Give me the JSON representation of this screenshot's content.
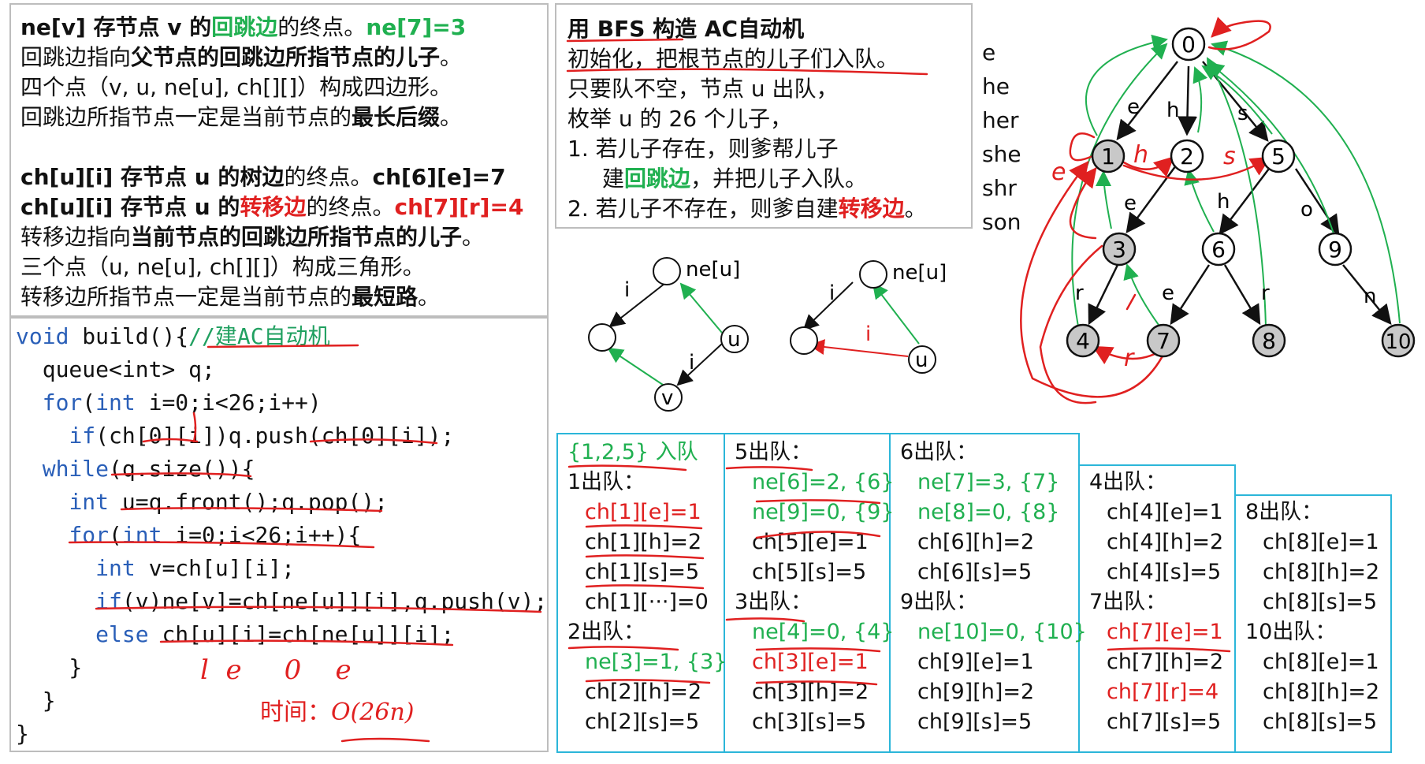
{
  "notes": {
    "line1": [
      "ne[v] 存节点 v 的",
      "回跳边",
      "的终点。",
      "ne[7]=3"
    ],
    "line2": [
      "回跳边指向",
      "父节点的回跳边所指节点的儿子",
      "。"
    ],
    "line3": "四个点（v, u, ne[u], ch[][]）构成四边形。",
    "line4": [
      "回跳边所指节点一定是当前节点的",
      "最长后缀",
      "。"
    ],
    "line5": [
      "ch[u][i] 存节点 u 的",
      "树边",
      "的终点。",
      "ch[6][e]=7"
    ],
    "line6": [
      "ch[u][i] 存节点 u 的",
      "转移边",
      "的终点。",
      "ch[7][r]=4"
    ],
    "line7": [
      "转移边指向",
      "当前节点的回跳边所指节点的儿子",
      "。"
    ],
    "line8": "三个点（u, ne[u], ch[][]）构成三角形。",
    "line9": [
      "转移边所指节点一定是当前节点的",
      "最短路",
      "。"
    ]
  },
  "algo": {
    "title": "用 BFS 构造 AC自动机",
    "lines": [
      "初始化，把根节点的儿子们入队。",
      "只要队不空，节点 u 出队，",
      "枚举 u 的 26 个儿子，",
      "1.  若儿子存在，则爹帮儿子"
    ],
    "line5": [
      "建",
      "回跳边",
      "，并把儿子入队。"
    ],
    "line6": [
      "2.  若儿子不存在，则爹自建",
      "转移边",
      "。"
    ]
  },
  "words": [
    "e",
    "he",
    "her",
    "she",
    "shr",
    "son"
  ],
  "code": {
    "l1": [
      "void",
      " build(){",
      "//建AC自动机"
    ],
    "l2": "  queue<int> q;",
    "l3": [
      "  ",
      "for",
      "(",
      "int",
      " i=0;i<26;i++)"
    ],
    "l4": [
      "    ",
      "if",
      "(ch[0][i])q.push(ch[0][i]);"
    ],
    "l5": [
      "  ",
      "while",
      "(q.size()){"
    ],
    "l6": [
      "    ",
      "int",
      " u=q.front();q.pop();"
    ],
    "l7": [
      "    ",
      "for",
      "(",
      "int",
      " i=0;i<26;i++){"
    ],
    "l8": [
      "      ",
      "int",
      " v=ch[u][i];"
    ],
    "l9": [
      "      ",
      "if",
      "(v)ne[v]=ch[ne[u]][i],q.push(v);"
    ],
    "l10": [
      "      ",
      "else",
      " ch[u][i]=ch[ne[u]][i];"
    ],
    "l11": "    }",
    "l12": "  }",
    "l13": "}",
    "time_label": "时间：",
    "time_value": "O(26n)",
    "scribble": "l  e     0    e"
  },
  "small_diagrams": {
    "quad": {
      "ne_u": "ne[u]",
      "u": "u",
      "v": "v",
      "i1": "i",
      "i2": "i"
    },
    "tri": {
      "ne_u": "ne[u]",
      "u": "u",
      "i1": "i",
      "i2": "i"
    }
  },
  "trie": {
    "nodes": [
      "0",
      "1",
      "2",
      "5",
      "3",
      "6",
      "9",
      "4",
      "7",
      "8",
      "10"
    ],
    "edge_labels": [
      "e",
      "h",
      "s",
      "e",
      "h",
      "o",
      "r",
      "e",
      "r",
      "n"
    ],
    "scribbles": [
      "e",
      "h",
      "s",
      "r"
    ]
  },
  "queue_cols": [
    {
      "c1": [
        {
          "t": "{1,2,5} 入队",
          "c": "green"
        },
        {
          "t": "1出队：",
          "c": ""
        },
        {
          "t": "ch[1][e]=1",
          "c": "red"
        },
        {
          "t": "ch[1][h]=2",
          "c": ""
        },
        {
          "t": "ch[1][s]=5",
          "c": ""
        },
        {
          "t": "ch[1][···]=0",
          "c": ""
        },
        {
          "t": "2出队：",
          "c": ""
        },
        {
          "t": "ne[3]=1, {3}",
          "c": "green"
        },
        {
          "t": "ch[2][h]=2",
          "c": ""
        },
        {
          "t": "ch[2][s]=5",
          "c": ""
        }
      ]
    },
    {
      "c2": [
        {
          "t": "5出队：",
          "c": ""
        },
        {
          "t": "ne[6]=2, {6}",
          "c": "green"
        },
        {
          "t": "ne[9]=0, {9}",
          "c": "green"
        },
        {
          "t": "ch[5][e]=1",
          "c": ""
        },
        {
          "t": "ch[5][s]=5",
          "c": ""
        },
        {
          "t": "3出队：",
          "c": ""
        },
        {
          "t": "ne[4]=0, {4}",
          "c": "green"
        },
        {
          "t": "ch[3][e]=1",
          "c": "red"
        },
        {
          "t": "ch[3][h]=2",
          "c": ""
        },
        {
          "t": "ch[3][s]=5",
          "c": ""
        }
      ]
    },
    {
      "c3": [
        {
          "t": "6出队：",
          "c": ""
        },
        {
          "t": "ne[7]=3, {7}",
          "c": "green"
        },
        {
          "t": "ne[8]=0, {8}",
          "c": "green"
        },
        {
          "t": "ch[6][h]=2",
          "c": ""
        },
        {
          "t": "ch[6][s]=5",
          "c": ""
        },
        {
          "t": "9出队：",
          "c": ""
        },
        {
          "t": "ne[10]=0, {10}",
          "c": "green"
        },
        {
          "t": "ch[9][e]=1",
          "c": ""
        },
        {
          "t": "ch[9][h]=2",
          "c": ""
        },
        {
          "t": "ch[9][s]=5",
          "c": ""
        }
      ]
    },
    {
      "c4": [
        {
          "t": "4出队：",
          "c": ""
        },
        {
          "t": "ch[4][e]=1",
          "c": ""
        },
        {
          "t": "ch[4][h]=2",
          "c": ""
        },
        {
          "t": "ch[4][s]=5",
          "c": ""
        },
        {
          "t": "7出队：",
          "c": ""
        },
        {
          "t": "ch[7][e]=1",
          "c": "red"
        },
        {
          "t": "ch[7][h]=2",
          "c": ""
        },
        {
          "t": "ch[7][r]=4",
          "c": "red"
        },
        {
          "t": "ch[7][s]=5",
          "c": ""
        }
      ]
    },
    {
      "c5": [
        {
          "t": "8出队：",
          "c": ""
        },
        {
          "t": "ch[8][e]=1",
          "c": ""
        },
        {
          "t": "ch[8][h]=2",
          "c": ""
        },
        {
          "t": "ch[8][s]=5",
          "c": ""
        },
        {
          "t": "10出队：",
          "c": ""
        },
        {
          "t": "ch[8][e]=1",
          "c": ""
        },
        {
          "t": "ch[8][h]=2",
          "c": ""
        },
        {
          "t": "ch[8][s]=5",
          "c": ""
        }
      ]
    }
  ],
  "colors": {
    "green": "#20b050",
    "red": "#e02020",
    "cyan": "#2bb6d9",
    "node_gray": "#c8c8c8",
    "code_blue": "#2a5fb8"
  }
}
